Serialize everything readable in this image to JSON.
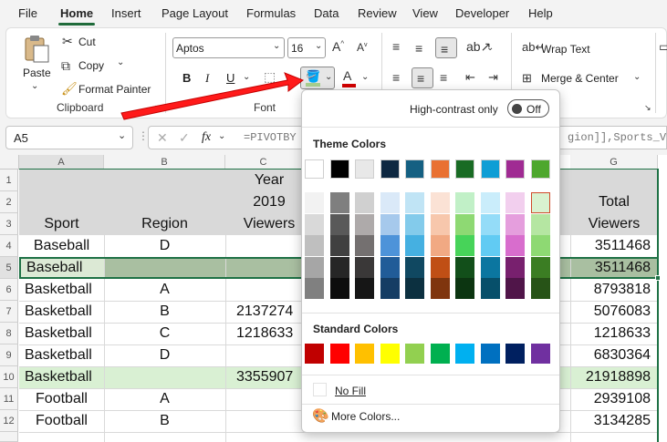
{
  "menu": [
    "File",
    "Home",
    "Insert",
    "Page Layout",
    "Formulas",
    "Data",
    "Review",
    "View",
    "Developer",
    "Help"
  ],
  "clipboard": {
    "paste": "Paste",
    "cut": "Cut",
    "copy": "Copy",
    "format_painter": "Format Painter",
    "group": "Clipboard"
  },
  "font": {
    "name": "Aptos",
    "size": "16",
    "bold": "B",
    "italic": "I",
    "underline": "U",
    "group": "Font"
  },
  "alignment": {
    "wrap_text": "Wrap Text",
    "merge_center": "Merge & Center"
  },
  "formula_bar": {
    "name_box": "A5",
    "fx": "fx",
    "formula_left": "=PIVOTBY",
    "formula_right": "gion]],Sports_V"
  },
  "columns": [
    "A",
    "B",
    "C",
    "G"
  ],
  "rows": [
    "1",
    "2",
    "3",
    "4",
    "5",
    "6",
    "7",
    "8",
    "9",
    "10",
    "11",
    "12"
  ],
  "sheet": {
    "header_year": "Year",
    "header_2019": "2019",
    "header_viewers": "Viewers",
    "header_sport": "Sport",
    "header_region": "Region",
    "header_total": "Total",
    "header_total_viewers": "Viewers",
    "data": [
      {
        "sport": "Baseball",
        "region": "D",
        "c": "",
        "g": "3511468"
      },
      {
        "sport": "Baseball",
        "region": "",
        "c": "",
        "g": "3511468"
      },
      {
        "sport": "Basketball",
        "region": "A",
        "c": "",
        "g": "8793818"
      },
      {
        "sport": "Basketball",
        "region": "B",
        "c": "2137274",
        "g": "5076083"
      },
      {
        "sport": "Basketball",
        "region": "C",
        "c": "1218633",
        "g": "1218633"
      },
      {
        "sport": "Basketball",
        "region": "D",
        "c": "",
        "g": "6830364"
      },
      {
        "sport": "Basketball",
        "region": "",
        "c": "3355907",
        "g": "21918898"
      },
      {
        "sport": "Football",
        "region": "A",
        "c": "",
        "g": "2939108"
      },
      {
        "sport": "Football",
        "region": "B",
        "c": "",
        "g": "3134285"
      }
    ]
  },
  "dropdown": {
    "high_contrast_label": "High-contrast only",
    "toggle_state": "Off",
    "theme_colors_heading": "Theme Colors",
    "standard_colors_heading": "Standard Colors",
    "no_fill": "No Fill",
    "more_colors": "More Colors...",
    "theme_top_row": [
      "#ffffff",
      "#000000",
      "#e8e8e8",
      "#0e2841",
      "#156082",
      "#e97132",
      "#196b24",
      "#0f9ed5",
      "#a02b93",
      "#4ea72e"
    ],
    "theme_shades": [
      [
        "#f2f2f2",
        "#7f7f7f",
        "#d0d0d0",
        "#dae9f8",
        "#c0e4f5",
        "#fbe2d5",
        "#c1f0c7",
        "#caedfb",
        "#f2cfee",
        "#d9f2d0"
      ],
      [
        "#d9d9d9",
        "#595959",
        "#aeaaaa",
        "#a6c9ec",
        "#83cbeb",
        "#f7c7ac",
        "#8ed973",
        "#94dcf8",
        "#e59edd",
        "#b5e6a2"
      ],
      [
        "#bfbfbf",
        "#404040",
        "#747070",
        "#4d93d9",
        "#45b0e1",
        "#f1a983",
        "#47d359",
        "#61cbf3",
        "#d86dcd",
        "#8ed973"
      ],
      [
        "#a6a6a6",
        "#262626",
        "#3a3838",
        "#215c98",
        "#104861",
        "#c04f15",
        "#124f1a",
        "#0b76a0",
        "#78206e",
        "#3b7d23"
      ],
      [
        "#808080",
        "#0d0d0d",
        "#161616",
        "#153d64",
        "#0c3040",
        "#7f350e",
        "#0c3511",
        "#074f6a",
        "#501549",
        "#275317"
      ]
    ],
    "standard": [
      "#c00000",
      "#ff0000",
      "#ffc000",
      "#ffff00",
      "#92d050",
      "#00b050",
      "#00b0f0",
      "#0070c0",
      "#002060",
      "#7030a0"
    ]
  }
}
